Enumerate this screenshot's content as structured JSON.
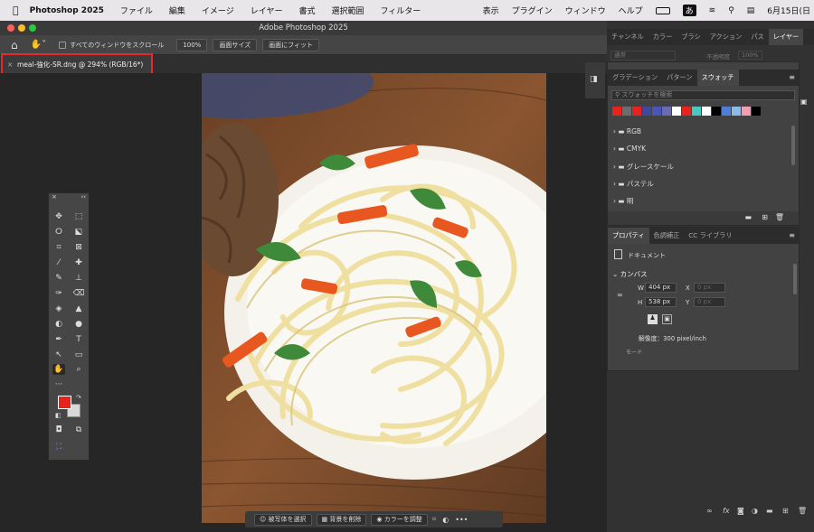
{
  "menubar": {
    "app": "Photoshop 2025",
    "items": [
      "ファイル",
      "編集",
      "イメージ",
      "レイヤー",
      "書式",
      "選択範囲",
      "フィルター"
    ],
    "right_items": [
      "表示",
      "プラグイン",
      "ウィンドウ",
      "ヘルプ"
    ],
    "ime": "あ",
    "date": "6月15日(日"
  },
  "window": {
    "title": "Adobe Photoshop 2025"
  },
  "options": {
    "scroll_all_label": "すべてのウィンドウをスクロール",
    "zoom_100": "100%",
    "fit_screen": "画面サイズ",
    "fill_screen": "画面にフィット"
  },
  "document": {
    "tab_title": "meal-強化-SR.dng @ 294% (RGB/16*)"
  },
  "context_bar": {
    "select_subject": "被写体を選択",
    "remove_bg": "背景を削除",
    "color_adjust": "カラーを調整"
  },
  "layers_panel": {
    "tabs": [
      "チャンネル",
      "カラー",
      "ブラシ",
      "アクション",
      "パス",
      "レイヤー"
    ],
    "blend": "通常",
    "opacity_label": "不透明度",
    "opacity": "100%"
  },
  "swatches_panel": {
    "tabs": [
      "グラデーション",
      "パターン",
      "スウォッチ"
    ],
    "search_placeholder": "スウォッチを検索",
    "swatches": [
      "#e8231e",
      "#6d6d6d",
      "#e8231e",
      "#3d4aa0",
      "#4a55b5",
      "#6a6ab5",
      "#ffffff",
      "#e8231e",
      "#4dc8c0",
      "#ffffff",
      "#000000",
      "#4d7fd6",
      "#8dbbe8",
      "#f0a0b0",
      "#000000"
    ],
    "folders": [
      "RGB",
      "CMYK",
      "グレースケール",
      "パステル",
      "明"
    ]
  },
  "properties_panel": {
    "tabs": [
      "プロパティ",
      "色調補正",
      "CC ライブラリ"
    ],
    "doc_label": "ドキュメント",
    "canvas_section": "カンバス",
    "w_label": "W",
    "w_value": "404 px",
    "h_label": "H",
    "h_value": "538 px",
    "x_label": "X",
    "x_placeholder": "0 px",
    "y_label": "Y",
    "y_placeholder": "0 px",
    "resolution": "解像度：300 pixel/inch",
    "mode_label": "モード"
  },
  "colors": {
    "foreground": "#e8231e",
    "background": "#d8d8d8",
    "highlight": "#e52b2b"
  }
}
